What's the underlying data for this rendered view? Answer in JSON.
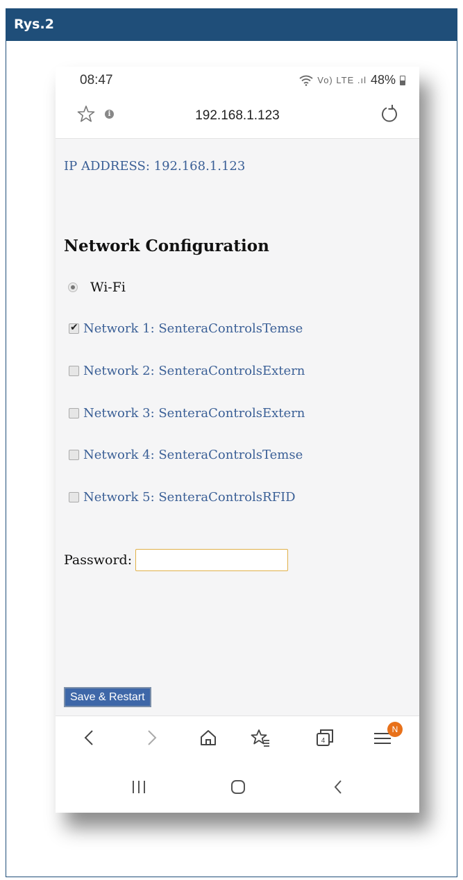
{
  "header": {
    "title": "Rys.2"
  },
  "status_bar": {
    "time": "08:47",
    "icons": "Vo) LTE .ıl",
    "battery": "48%"
  },
  "url_bar": {
    "url": "192.168.1.123"
  },
  "page": {
    "ip_line": "IP ADDRESS: 192.168.1.123",
    "section_title": "Network Configuration",
    "wifi_label": "Wi-Fi",
    "networks": [
      {
        "label": "Network 1: SenteraControlsTemse",
        "checked": true
      },
      {
        "label": "Network 2: SenteraControlsExtern",
        "checked": false
      },
      {
        "label": "Network 3: SenteraControlsExtern",
        "checked": false
      },
      {
        "label": "Network 4: SenteraControlsTemse",
        "checked": false
      },
      {
        "label": "Network 5: SenteraControlsRFID",
        "checked": false
      }
    ],
    "password_label": "Password:",
    "password_value": "",
    "save_label": "Save & Restart"
  },
  "browser_nav": {
    "tab_count": "4",
    "menu_badge": "N"
  },
  "colors": {
    "header": "#1f4e79",
    "link": "#3a5f96",
    "button": "#3e67a8",
    "badge": "#e8711a",
    "input_border": "#e0b048"
  },
  "icons": [
    "star-icon",
    "info-icon",
    "reload-icon",
    "back-icon",
    "forward-icon",
    "home-icon",
    "bookmarks-icon",
    "tabs-icon",
    "menu-icon",
    "recent-apps-icon",
    "home-button-icon",
    "system-back-icon"
  ]
}
